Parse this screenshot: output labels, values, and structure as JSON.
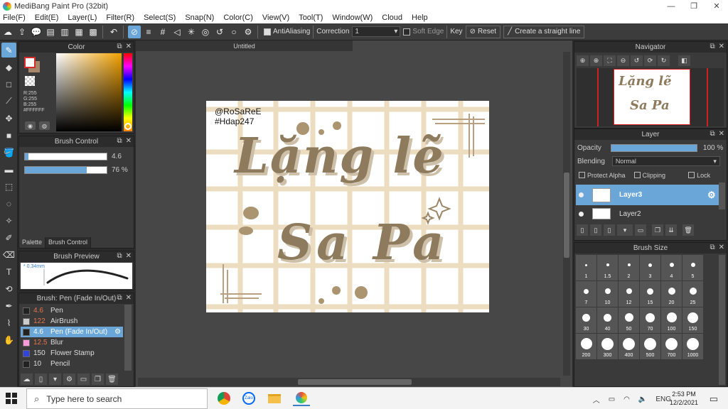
{
  "window": {
    "title": "MediBang Paint Pro (32bit)",
    "controls": [
      "—",
      "❐",
      "✕"
    ]
  },
  "menu": [
    "File(F)",
    "Edit(E)",
    "Layer(L)",
    "Filter(R)",
    "Select(S)",
    "Snap(N)",
    "Color(C)",
    "View(V)",
    "Tool(T)",
    "Window(W)",
    "Cloud",
    "Help"
  ],
  "toolbar": {
    "antialiasing_label": "AntiAliasing",
    "correction_label": "Correction",
    "correction_value": "1",
    "soft_edge_label": "Soft Edge",
    "key_label": "Key",
    "reset_label": "Reset",
    "straight_line_label": "Create a straight line"
  },
  "color_panel": {
    "title": "Color",
    "rgb": [
      "R:255",
      "G:255",
      "B:255",
      "#FFFFFF"
    ],
    "accent": "#f2a100"
  },
  "brush_control": {
    "title": "Brush Control",
    "size_value": "4.6",
    "size_fraction": 0.04,
    "opacity_value": "76 %",
    "opacity_fraction": 0.76,
    "tabs": [
      "Palette",
      "Brush Control"
    ]
  },
  "brush_preview": {
    "title": "Brush Preview",
    "size_text": "* 0.34mm"
  },
  "brush_list": {
    "title": "Brush: Pen (Fade In/Out)",
    "items": [
      {
        "num": "4.6",
        "name": "Pen",
        "color": "#222222"
      },
      {
        "num": "122",
        "name": "AirBrush",
        "color": "#cccccc"
      },
      {
        "num": "4.6",
        "name": "Pen (Fade In/Out)",
        "color": "#222222"
      },
      {
        "num": "12.5",
        "name": "Blur",
        "color": "#ff99dd"
      },
      {
        "num": "150",
        "name": "Flower Stamp",
        "color": "#3344dd"
      },
      {
        "num": "10",
        "name": "Pencil",
        "color": "#222222"
      }
    ]
  },
  "document": {
    "tab": "Untitled",
    "watermark": [
      "@RoSaReE",
      "#Hdap247"
    ],
    "title_line1": "Lặng lẽ",
    "title_line2": "Sa Pa"
  },
  "navigator": {
    "title": "Navigator"
  },
  "layer_panel": {
    "title": "Layer",
    "opacity_label": "Opacity",
    "opacity_value": "100 %",
    "blending_label": "Blending",
    "blending_value": "Normal",
    "protect_alpha": "Protect Alpha",
    "clipping": "Clipping",
    "lock": "Lock",
    "layers": [
      "Layer3",
      "Layer2"
    ]
  },
  "brush_size": {
    "title": "Brush Size",
    "sizes": [
      "1",
      "1.5",
      "2",
      "3",
      "4",
      "5",
      "7",
      "10",
      "12",
      "15",
      "20",
      "25",
      "30",
      "40",
      "50",
      "70",
      "100",
      "150",
      "200",
      "300",
      "400",
      "500",
      "700",
      "1000"
    ]
  },
  "taskbar": {
    "search_placeholder": "Type here to search",
    "lang": "ENG",
    "time": "2:53 PM",
    "date": "12/2/2021"
  }
}
